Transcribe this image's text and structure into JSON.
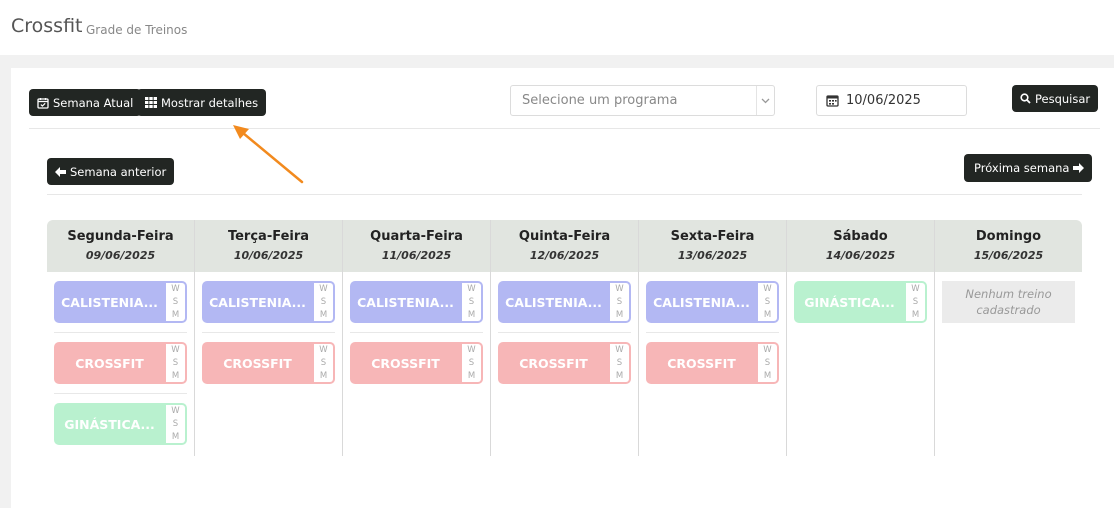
{
  "header": {
    "title": "Crossfit",
    "subtitle": "Grade de Treinos"
  },
  "toolbar": {
    "current_week_label": "Semana Atual",
    "show_details_label": "Mostrar detalhes",
    "program_placeholder": "Selecione um programa",
    "date_value": "10/06/2025",
    "search_label": "Pesquisar"
  },
  "nav": {
    "prev_label": "Semana anterior",
    "next_label": "Próxima semana"
  },
  "colors": {
    "blue": "#b3b8f3",
    "red": "#f7b6b7",
    "green": "#b9f1cf",
    "header_bg": "#e1e5e0",
    "button_dark": "#222623",
    "arrow": "#f28a1e"
  },
  "days": [
    {
      "name": "Segunda-Feira",
      "date": "09/06/2025",
      "trainings": [
        {
          "label": "CALISTENIA...",
          "w": "W",
          "s": "S",
          "m": "M"
        },
        {
          "label": "CROSSFIT",
          "w": "W",
          "s": "S",
          "m": "M"
        },
        {
          "label": "GINÁSTICA...",
          "w": "W",
          "s": "S",
          "m": "M"
        }
      ]
    },
    {
      "name": "Terça-Feira",
      "date": "10/06/2025",
      "trainings": [
        {
          "label": "CALISTENIA...",
          "w": "W",
          "s": "S",
          "m": "M"
        },
        {
          "label": "CROSSFIT",
          "w": "W",
          "s": "S",
          "m": "M"
        }
      ]
    },
    {
      "name": "Quarta-Feira",
      "date": "11/06/2025",
      "trainings": [
        {
          "label": "CALISTENIA...",
          "w": "W",
          "s": "S",
          "m": "M"
        },
        {
          "label": "CROSSFIT",
          "w": "W",
          "s": "S",
          "m": "M"
        }
      ]
    },
    {
      "name": "Quinta-Feira",
      "date": "12/06/2025",
      "trainings": [
        {
          "label": "CALISTENIA...",
          "w": "W",
          "s": "S",
          "m": "M"
        },
        {
          "label": "CROSSFIT",
          "w": "W",
          "s": "S",
          "m": "M"
        }
      ]
    },
    {
      "name": "Sexta-Feira",
      "date": "13/06/2025",
      "trainings": [
        {
          "label": "CALISTENIA...",
          "w": "W",
          "s": "S",
          "m": "M"
        },
        {
          "label": "CROSSFIT",
          "w": "W",
          "s": "S",
          "m": "M"
        }
      ]
    },
    {
      "name": "Sábado",
      "date": "14/06/2025",
      "trainings": [
        {
          "label": "GINÁSTICA...",
          "w": "W",
          "s": "S",
          "m": "M"
        }
      ]
    },
    {
      "name": "Domingo",
      "date": "15/06/2025",
      "empty_text": "Nenhum treino cadastrado"
    }
  ]
}
